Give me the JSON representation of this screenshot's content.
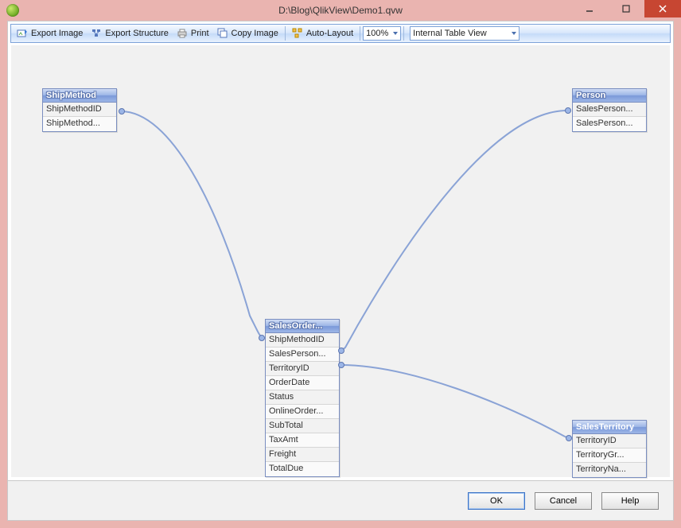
{
  "window": {
    "title": "D:\\Blog\\QlikView\\Demo1.qvw"
  },
  "toolbar": {
    "export_image": "Export Image",
    "export_structure": "Export Structure",
    "print": "Print",
    "copy_image": "Copy Image",
    "auto_layout": "Auto-Layout",
    "zoom_value": "100%",
    "view_value": "Internal Table View"
  },
  "tables": {
    "ship_method": {
      "title": "ShipMethod",
      "fields": [
        "ShipMethodID",
        "ShipMethod..."
      ]
    },
    "person": {
      "title": "Person",
      "fields": [
        "SalesPerson...",
        "SalesPerson..."
      ]
    },
    "sales_order": {
      "title": "SalesOrder...",
      "fields": [
        "ShipMethodID",
        "SalesPerson...",
        "TerritoryID",
        "OrderDate",
        "Status",
        "OnlineOrder...",
        "SubTotal",
        "TaxAmt",
        "Freight",
        "TotalDue"
      ]
    },
    "sales_territory": {
      "title": "SalesTerritory",
      "fields": [
        "TerritoryID",
        "TerritoryGr...",
        "TerritoryNa..."
      ]
    }
  },
  "dialog": {
    "ok": "OK",
    "cancel": "Cancel",
    "help": "Help"
  }
}
